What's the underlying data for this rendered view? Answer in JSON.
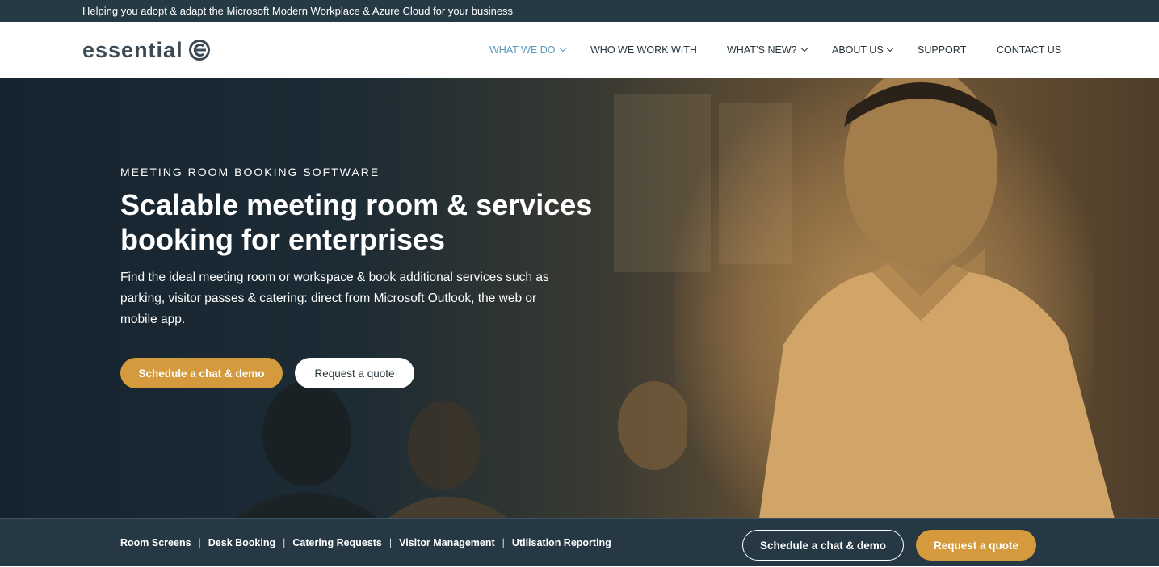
{
  "topbar": {
    "text": "Helping you adopt & adapt the Microsoft Modern Workplace & Azure Cloud for your business"
  },
  "logo": {
    "text": "essential"
  },
  "nav": {
    "items": [
      {
        "label": "WHAT WE DO"
      },
      {
        "label": "WHO WE WORK WITH"
      },
      {
        "label": "WHAT’S NEW?"
      },
      {
        "label": "ABOUT US"
      },
      {
        "label": "SUPPORT"
      },
      {
        "label": "CONTACT US"
      }
    ]
  },
  "hero": {
    "eyebrow": "MEETING ROOM BOOKING SOFTWARE",
    "headline": "Scalable meeting room & services booking for enterprises",
    "lead": "Find the ideal meeting room or workspace & book additional services such as parking, visitor passes & catering: direct from Microsoft Outlook, the web or mobile app.",
    "primary_cta": "Schedule a chat & demo",
    "secondary_cta": "Request a quote"
  },
  "bottombar": {
    "links": [
      {
        "label": "Room Screens"
      },
      {
        "label": "Desk Booking"
      },
      {
        "label": "Catering Requests"
      },
      {
        "label": "Visitor Management"
      },
      {
        "label": "Utilisation Reporting"
      }
    ],
    "separator": "|",
    "schedule_label": "Schedule a chat & demo",
    "quote_label": "Request a quote"
  },
  "colors": {
    "brand_dark": "#263a46",
    "accent_gold": "#d49a3d",
    "nav_active": "#5a9bbd"
  }
}
